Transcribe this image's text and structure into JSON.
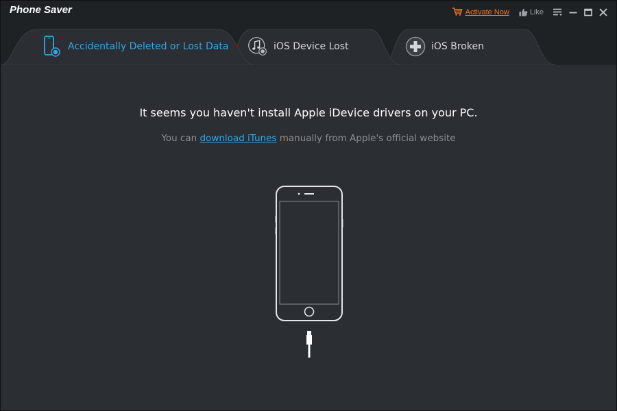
{
  "app": {
    "title": "Phone Saver"
  },
  "titlebar": {
    "activate_label": "Activate Now",
    "like_label": "Like",
    "activate_color": "#f07a2c",
    "icons": [
      "cart-icon",
      "thumbs-up-icon",
      "menu-icon",
      "minimize-icon",
      "maximize-icon",
      "close-icon"
    ]
  },
  "tabs": [
    {
      "label": "Accidentally Deleted or Lost Data",
      "icon": "phone-restore-icon",
      "active": true
    },
    {
      "label": "iOS Device Lost",
      "icon": "music-restore-icon",
      "active": false
    },
    {
      "label": "iOS Broken",
      "icon": "plus-circle-icon",
      "active": false
    }
  ],
  "main": {
    "headline": "It seems you haven't install Apple iDevice drivers on your PC.",
    "sub_prefix": "You can ",
    "sub_link": "download iTunes",
    "sub_suffix": " manually from Apple's official website",
    "accent_color": "#35a7e6",
    "illustration": "iphone-with-lightning-cable"
  }
}
